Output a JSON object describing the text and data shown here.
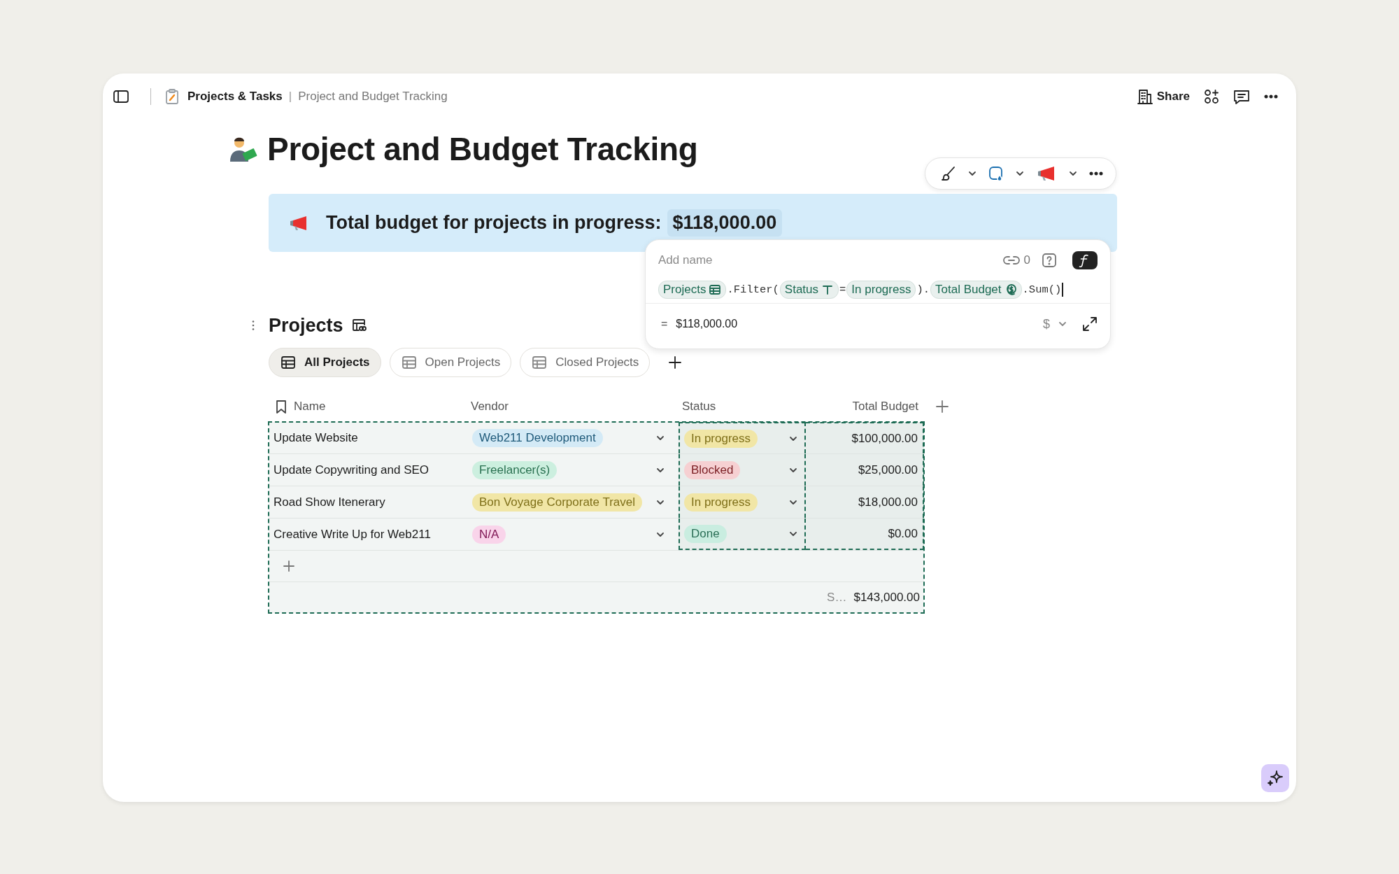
{
  "breadcrumb": {
    "workspace": "Projects & Tasks",
    "separator": "|",
    "page": "Project and Budget Tracking"
  },
  "topbar_actions": {
    "share": "Share"
  },
  "title": "Project and Budget Tracking",
  "callout": {
    "text": "Total budget for projects in progress:",
    "value": "$118,000.00"
  },
  "formula_popover": {
    "name_placeholder": "Add name",
    "link_count": "0",
    "tokens": [
      {
        "kind": "table",
        "label": "Projects"
      },
      {
        "kind": "code",
        "label": ".Filter("
      },
      {
        "kind": "text",
        "label": "Status"
      },
      {
        "kind": "code",
        "label": "="
      },
      {
        "kind": "value",
        "label": "In progress"
      },
      {
        "kind": "code",
        "label": ")."
      },
      {
        "kind": "currency",
        "label": "Total Budget"
      },
      {
        "kind": "code",
        "label": ".Sum()"
      }
    ],
    "equals": "=",
    "result": "$118,000.00",
    "format": "$"
  },
  "section": {
    "title": "Projects"
  },
  "views": [
    {
      "label": "All Projects",
      "selected": true
    },
    {
      "label": "Open Projects",
      "selected": false
    },
    {
      "label": "Closed Projects",
      "selected": false
    }
  ],
  "table": {
    "highlighted": true,
    "columns": [
      {
        "label": "Name",
        "highlighted": false
      },
      {
        "label": "Vendor",
        "highlighted": false
      },
      {
        "label": "Status",
        "highlighted": true
      },
      {
        "label": "Total Budget",
        "highlighted": true
      }
    ],
    "rows": [
      {
        "name": "Update Website",
        "vendor": {
          "label": "Web211 Development",
          "color": "#d4eaf6"
        },
        "status": {
          "label": "In progress",
          "color": "#f1e6a6"
        },
        "budget": "$100,000.00"
      },
      {
        "name": "Update Copywriting and SEO",
        "vendor": {
          "label": "Freelancer(s)",
          "color": "#ccefdf"
        },
        "status": {
          "label": "Blocked",
          "color": "#f6d0d2"
        },
        "budget": "$25,000.00"
      },
      {
        "name": "Road Show Itenerary",
        "vendor": {
          "label": "Bon Voyage Corporate Travel",
          "color": "#f1e6a6"
        },
        "status": {
          "label": "In progress",
          "color": "#f1e6a6"
        },
        "budget": "$18,000.00"
      },
      {
        "name": "Creative Write Up for Web211",
        "vendor": {
          "label": "N/A",
          "color": "#f9d4ea"
        },
        "status": {
          "label": "Done",
          "color": "#c9ede0"
        },
        "budget": "$0.00"
      }
    ],
    "footer": {
      "label": "S…",
      "value": "$143,000.00"
    }
  }
}
